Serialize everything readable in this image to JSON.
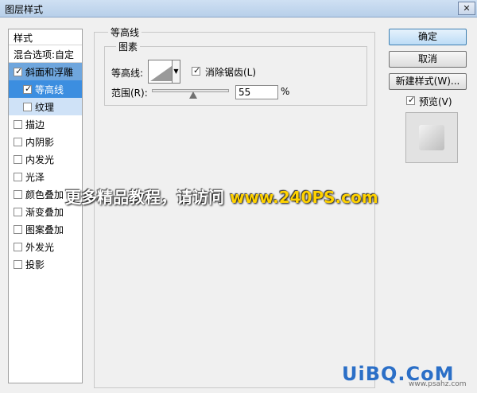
{
  "window": {
    "title": "图层样式",
    "close_label": "✕"
  },
  "left_panel": {
    "styles_label": "样式",
    "blend_options_label": "混合选项:自定",
    "items": [
      {
        "label": "斜面和浮雕",
        "checked": true
      },
      {
        "label": "等高线",
        "checked": true
      },
      {
        "label": "纹理",
        "checked": false
      },
      {
        "label": "描边",
        "checked": false
      },
      {
        "label": "内阴影",
        "checked": false
      },
      {
        "label": "内发光",
        "checked": false
      },
      {
        "label": "光泽",
        "checked": false
      },
      {
        "label": "颜色叠加",
        "checked": false
      },
      {
        "label": "渐变叠加",
        "checked": false
      },
      {
        "label": "图案叠加",
        "checked": false
      },
      {
        "label": "外发光",
        "checked": false
      },
      {
        "label": "投影",
        "checked": false
      }
    ]
  },
  "contour_panel": {
    "section_title": "等高线",
    "group_title": "图素",
    "contour_label": "等高线:",
    "anti_alias_label": "消除锯齿(L)",
    "anti_alias_checked": true,
    "range_label": "范围(R):",
    "range_value": "55",
    "range_unit": "%",
    "range_percent": 55
  },
  "buttons": {
    "ok": "确定",
    "cancel": "取消",
    "new_style": "新建样式(W)...",
    "preview_label": "预览(V)",
    "preview_checked": true
  },
  "watermark": {
    "text": "更多精品教程，请访问",
    "url": "www.240PS.com"
  },
  "logo": {
    "text": "UiBQ.CoM",
    "url": "www.psahz.com"
  },
  "colors": {
    "selected_row": "#6fa6dd",
    "selected_subrow": "#3c8ee0",
    "title_bar": "#b7cfe9"
  }
}
